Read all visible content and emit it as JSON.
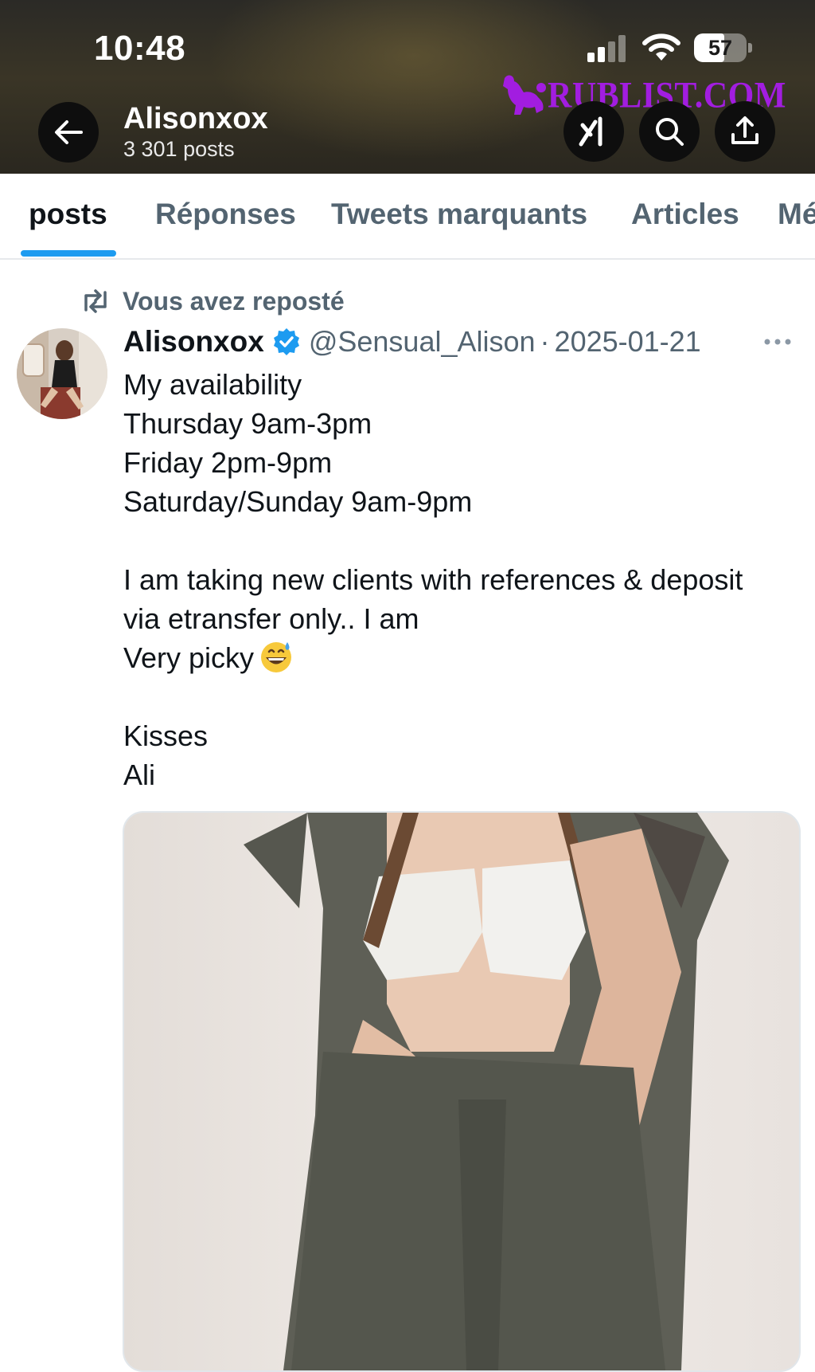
{
  "status_bar": {
    "time": "10:48",
    "battery_percent": "57",
    "battery_level": 0.57
  },
  "header": {
    "title": "Alisonxox",
    "subtitle": "3 301 posts",
    "watermark": "RUBLIST.COM",
    "back_icon": "arrow-left-icon",
    "buttons": [
      "grok-icon",
      "search-icon",
      "share-icon"
    ]
  },
  "tabs": {
    "items": [
      {
        "label": "posts",
        "active": true
      },
      {
        "label": "Réponses",
        "active": false
      },
      {
        "label": "Tweets marquants",
        "active": false
      },
      {
        "label": "Articles",
        "active": false
      },
      {
        "label": "Mé",
        "active": false
      }
    ]
  },
  "post": {
    "repost_label": "Vous avez reposté",
    "author_name": "Alisonxox",
    "handle": "@Sensual_Alison",
    "separator": "·",
    "date": "2025-01-21",
    "lines": [
      "My availability",
      "Thursday 9am-3pm",
      "Friday 2pm-9pm",
      "Saturday/Sunday 9am-9pm",
      "",
      "I am taking new clients with references & deposit",
      "via etransfer only.. I am",
      "Very picky",
      "",
      "Kisses",
      "Ali"
    ],
    "emoji": "grinning-face-with-sweat",
    "colors": {
      "verified": "#1d9bf0",
      "accent": "#1d9bf0",
      "muted": "#536471"
    }
  }
}
